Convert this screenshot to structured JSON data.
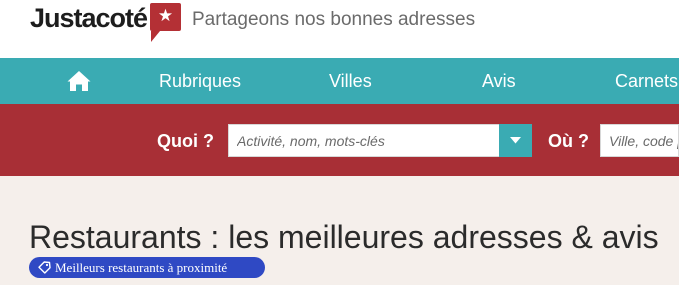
{
  "header": {
    "logo_text": "Justacoté",
    "logo_badge_glyph": "★",
    "tagline": "Partageons nos bonnes adresses"
  },
  "nav": {
    "home_icon": "home-icon",
    "items": [
      "Rubriques",
      "Villes",
      "Avis",
      "Carnets"
    ]
  },
  "search": {
    "quoi_label": "Quoi ?",
    "quoi_placeholder": "Activité, nom, mots-clés",
    "ou_label": "Où ?",
    "ou_placeholder": "Ville, code postal",
    "dropdown_icon": "chevron-down-icon"
  },
  "main": {
    "title": "Restaurants : les meilleures adresses & avis",
    "tag_label": "Meilleurs restaurants à proximité",
    "tag_icon": "tag-icon"
  },
  "colors": {
    "nav_teal": "#3aabb3",
    "search_red": "#a82f36",
    "logo_red": "#b43035",
    "tag_blue": "#2f49c4",
    "page_bg": "#f5efeb"
  }
}
